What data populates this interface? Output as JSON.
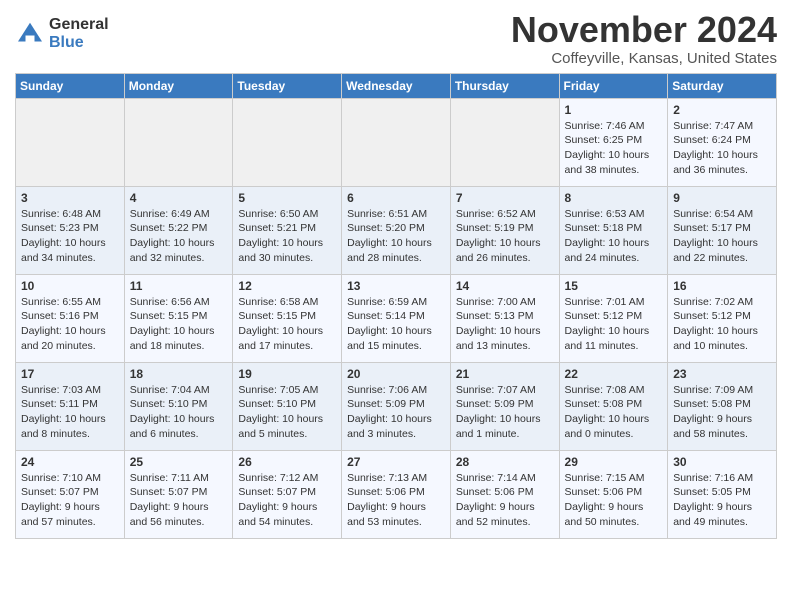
{
  "logo": {
    "general": "General",
    "blue": "Blue"
  },
  "title": "November 2024",
  "location": "Coffeyville, Kansas, United States",
  "weekdays": [
    "Sunday",
    "Monday",
    "Tuesday",
    "Wednesday",
    "Thursday",
    "Friday",
    "Saturday"
  ],
  "weeks": [
    [
      {
        "day": "",
        "text": ""
      },
      {
        "day": "",
        "text": ""
      },
      {
        "day": "",
        "text": ""
      },
      {
        "day": "",
        "text": ""
      },
      {
        "day": "",
        "text": ""
      },
      {
        "day": "1",
        "text": "Sunrise: 7:46 AM\nSunset: 6:25 PM\nDaylight: 10 hours and 38 minutes."
      },
      {
        "day": "2",
        "text": "Sunrise: 7:47 AM\nSunset: 6:24 PM\nDaylight: 10 hours and 36 minutes."
      }
    ],
    [
      {
        "day": "3",
        "text": "Sunrise: 6:48 AM\nSunset: 5:23 PM\nDaylight: 10 hours and 34 minutes."
      },
      {
        "day": "4",
        "text": "Sunrise: 6:49 AM\nSunset: 5:22 PM\nDaylight: 10 hours and 32 minutes."
      },
      {
        "day": "5",
        "text": "Sunrise: 6:50 AM\nSunset: 5:21 PM\nDaylight: 10 hours and 30 minutes."
      },
      {
        "day": "6",
        "text": "Sunrise: 6:51 AM\nSunset: 5:20 PM\nDaylight: 10 hours and 28 minutes."
      },
      {
        "day": "7",
        "text": "Sunrise: 6:52 AM\nSunset: 5:19 PM\nDaylight: 10 hours and 26 minutes."
      },
      {
        "day": "8",
        "text": "Sunrise: 6:53 AM\nSunset: 5:18 PM\nDaylight: 10 hours and 24 minutes."
      },
      {
        "day": "9",
        "text": "Sunrise: 6:54 AM\nSunset: 5:17 PM\nDaylight: 10 hours and 22 minutes."
      }
    ],
    [
      {
        "day": "10",
        "text": "Sunrise: 6:55 AM\nSunset: 5:16 PM\nDaylight: 10 hours and 20 minutes."
      },
      {
        "day": "11",
        "text": "Sunrise: 6:56 AM\nSunset: 5:15 PM\nDaylight: 10 hours and 18 minutes."
      },
      {
        "day": "12",
        "text": "Sunrise: 6:58 AM\nSunset: 5:15 PM\nDaylight: 10 hours and 17 minutes."
      },
      {
        "day": "13",
        "text": "Sunrise: 6:59 AM\nSunset: 5:14 PM\nDaylight: 10 hours and 15 minutes."
      },
      {
        "day": "14",
        "text": "Sunrise: 7:00 AM\nSunset: 5:13 PM\nDaylight: 10 hours and 13 minutes."
      },
      {
        "day": "15",
        "text": "Sunrise: 7:01 AM\nSunset: 5:12 PM\nDaylight: 10 hours and 11 minutes."
      },
      {
        "day": "16",
        "text": "Sunrise: 7:02 AM\nSunset: 5:12 PM\nDaylight: 10 hours and 10 minutes."
      }
    ],
    [
      {
        "day": "17",
        "text": "Sunrise: 7:03 AM\nSunset: 5:11 PM\nDaylight: 10 hours and 8 minutes."
      },
      {
        "day": "18",
        "text": "Sunrise: 7:04 AM\nSunset: 5:10 PM\nDaylight: 10 hours and 6 minutes."
      },
      {
        "day": "19",
        "text": "Sunrise: 7:05 AM\nSunset: 5:10 PM\nDaylight: 10 hours and 5 minutes."
      },
      {
        "day": "20",
        "text": "Sunrise: 7:06 AM\nSunset: 5:09 PM\nDaylight: 10 hours and 3 minutes."
      },
      {
        "day": "21",
        "text": "Sunrise: 7:07 AM\nSunset: 5:09 PM\nDaylight: 10 hours and 1 minute."
      },
      {
        "day": "22",
        "text": "Sunrise: 7:08 AM\nSunset: 5:08 PM\nDaylight: 10 hours and 0 minutes."
      },
      {
        "day": "23",
        "text": "Sunrise: 7:09 AM\nSunset: 5:08 PM\nDaylight: 9 hours and 58 minutes."
      }
    ],
    [
      {
        "day": "24",
        "text": "Sunrise: 7:10 AM\nSunset: 5:07 PM\nDaylight: 9 hours and 57 minutes."
      },
      {
        "day": "25",
        "text": "Sunrise: 7:11 AM\nSunset: 5:07 PM\nDaylight: 9 hours and 56 minutes."
      },
      {
        "day": "26",
        "text": "Sunrise: 7:12 AM\nSunset: 5:07 PM\nDaylight: 9 hours and 54 minutes."
      },
      {
        "day": "27",
        "text": "Sunrise: 7:13 AM\nSunset: 5:06 PM\nDaylight: 9 hours and 53 minutes."
      },
      {
        "day": "28",
        "text": "Sunrise: 7:14 AM\nSunset: 5:06 PM\nDaylight: 9 hours and 52 minutes."
      },
      {
        "day": "29",
        "text": "Sunrise: 7:15 AM\nSunset: 5:06 PM\nDaylight: 9 hours and 50 minutes."
      },
      {
        "day": "30",
        "text": "Sunrise: 7:16 AM\nSunset: 5:05 PM\nDaylight: 9 hours and 49 minutes."
      }
    ]
  ]
}
